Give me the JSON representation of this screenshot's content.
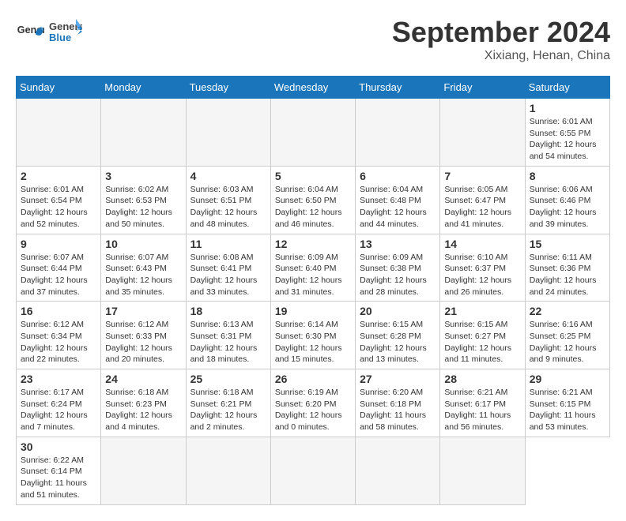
{
  "logo": {
    "text_general": "General",
    "text_blue": "Blue"
  },
  "title": "September 2024",
  "location": "Xixiang, Henan, China",
  "weekdays": [
    "Sunday",
    "Monday",
    "Tuesday",
    "Wednesday",
    "Thursday",
    "Friday",
    "Saturday"
  ],
  "days": [
    {
      "day": "",
      "info": ""
    },
    {
      "day": "",
      "info": ""
    },
    {
      "day": "",
      "info": ""
    },
    {
      "day": "",
      "info": ""
    },
    {
      "day": "",
      "info": ""
    },
    {
      "day": "",
      "info": ""
    },
    {
      "day": "1",
      "info": "Sunrise: 6:01 AM\nSunset: 6:55 PM\nDaylight: 12 hours\nand 54 minutes."
    },
    {
      "day": "2",
      "info": "Sunrise: 6:01 AM\nSunset: 6:54 PM\nDaylight: 12 hours\nand 52 minutes."
    },
    {
      "day": "3",
      "info": "Sunrise: 6:02 AM\nSunset: 6:53 PM\nDaylight: 12 hours\nand 50 minutes."
    },
    {
      "day": "4",
      "info": "Sunrise: 6:03 AM\nSunset: 6:51 PM\nDaylight: 12 hours\nand 48 minutes."
    },
    {
      "day": "5",
      "info": "Sunrise: 6:04 AM\nSunset: 6:50 PM\nDaylight: 12 hours\nand 46 minutes."
    },
    {
      "day": "6",
      "info": "Sunrise: 6:04 AM\nSunset: 6:48 PM\nDaylight: 12 hours\nand 44 minutes."
    },
    {
      "day": "7",
      "info": "Sunrise: 6:05 AM\nSunset: 6:47 PM\nDaylight: 12 hours\nand 41 minutes."
    },
    {
      "day": "8",
      "info": "Sunrise: 6:06 AM\nSunset: 6:46 PM\nDaylight: 12 hours\nand 39 minutes."
    },
    {
      "day": "9",
      "info": "Sunrise: 6:07 AM\nSunset: 6:44 PM\nDaylight: 12 hours\nand 37 minutes."
    },
    {
      "day": "10",
      "info": "Sunrise: 6:07 AM\nSunset: 6:43 PM\nDaylight: 12 hours\nand 35 minutes."
    },
    {
      "day": "11",
      "info": "Sunrise: 6:08 AM\nSunset: 6:41 PM\nDaylight: 12 hours\nand 33 minutes."
    },
    {
      "day": "12",
      "info": "Sunrise: 6:09 AM\nSunset: 6:40 PM\nDaylight: 12 hours\nand 31 minutes."
    },
    {
      "day": "13",
      "info": "Sunrise: 6:09 AM\nSunset: 6:38 PM\nDaylight: 12 hours\nand 28 minutes."
    },
    {
      "day": "14",
      "info": "Sunrise: 6:10 AM\nSunset: 6:37 PM\nDaylight: 12 hours\nand 26 minutes."
    },
    {
      "day": "15",
      "info": "Sunrise: 6:11 AM\nSunset: 6:36 PM\nDaylight: 12 hours\nand 24 minutes."
    },
    {
      "day": "16",
      "info": "Sunrise: 6:12 AM\nSunset: 6:34 PM\nDaylight: 12 hours\nand 22 minutes."
    },
    {
      "day": "17",
      "info": "Sunrise: 6:12 AM\nSunset: 6:33 PM\nDaylight: 12 hours\nand 20 minutes."
    },
    {
      "day": "18",
      "info": "Sunrise: 6:13 AM\nSunset: 6:31 PM\nDaylight: 12 hours\nand 18 minutes."
    },
    {
      "day": "19",
      "info": "Sunrise: 6:14 AM\nSunset: 6:30 PM\nDaylight: 12 hours\nand 15 minutes."
    },
    {
      "day": "20",
      "info": "Sunrise: 6:15 AM\nSunset: 6:28 PM\nDaylight: 12 hours\nand 13 minutes."
    },
    {
      "day": "21",
      "info": "Sunrise: 6:15 AM\nSunset: 6:27 PM\nDaylight: 12 hours\nand 11 minutes."
    },
    {
      "day": "22",
      "info": "Sunrise: 6:16 AM\nSunset: 6:25 PM\nDaylight: 12 hours\nand 9 minutes."
    },
    {
      "day": "23",
      "info": "Sunrise: 6:17 AM\nSunset: 6:24 PM\nDaylight: 12 hours\nand 7 minutes."
    },
    {
      "day": "24",
      "info": "Sunrise: 6:18 AM\nSunset: 6:23 PM\nDaylight: 12 hours\nand 4 minutes."
    },
    {
      "day": "25",
      "info": "Sunrise: 6:18 AM\nSunset: 6:21 PM\nDaylight: 12 hours\nand 2 minutes."
    },
    {
      "day": "26",
      "info": "Sunrise: 6:19 AM\nSunset: 6:20 PM\nDaylight: 12 hours\nand 0 minutes."
    },
    {
      "day": "27",
      "info": "Sunrise: 6:20 AM\nSunset: 6:18 PM\nDaylight: 11 hours\nand 58 minutes."
    },
    {
      "day": "28",
      "info": "Sunrise: 6:21 AM\nSunset: 6:17 PM\nDaylight: 11 hours\nand 56 minutes."
    },
    {
      "day": "29",
      "info": "Sunrise: 6:21 AM\nSunset: 6:15 PM\nDaylight: 11 hours\nand 53 minutes."
    },
    {
      "day": "30",
      "info": "Sunrise: 6:22 AM\nSunset: 6:14 PM\nDaylight: 11 hours\nand 51 minutes."
    },
    {
      "day": "",
      "info": ""
    },
    {
      "day": "",
      "info": ""
    },
    {
      "day": "",
      "info": ""
    },
    {
      "day": "",
      "info": ""
    },
    {
      "day": "",
      "info": ""
    }
  ]
}
